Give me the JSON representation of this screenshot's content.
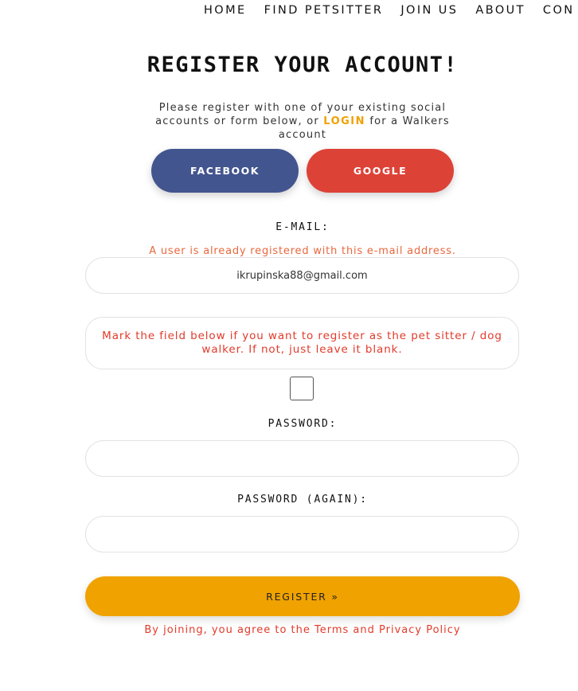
{
  "nav": {
    "items": [
      "HOME",
      "FIND PETSITTER",
      "JOIN US",
      "ABOUT",
      "CON"
    ]
  },
  "heading": "REGISTER YOUR ACCOUNT!",
  "intro": {
    "before": "Please register with one of your existing social accounts or form below, or ",
    "login_link": "LOGIN",
    "after": " for a Walkers account"
  },
  "social": {
    "facebook": "FACEBOOK",
    "google": "GOOGLE"
  },
  "email": {
    "label": "E-MAIL:",
    "error": "A user is already registered with this e-mail address.",
    "value": "ikrupinska88@gmail.com"
  },
  "petsitter": {
    "notice": "Mark the field below if you want to register as the pet sitter / dog walker. If not, just leave it blank."
  },
  "password": {
    "label": "PASSWORD:",
    "value": ""
  },
  "password_again": {
    "label": "PASSWORD (AGAIN):",
    "value": ""
  },
  "register_button": "REGISTER »",
  "terms": "By joining, you agree to the Terms and Privacy Policy",
  "colors": {
    "accent": "#f0a200",
    "facebook": "#43558f",
    "google": "#dd4237",
    "error": "#e23a2a"
  }
}
